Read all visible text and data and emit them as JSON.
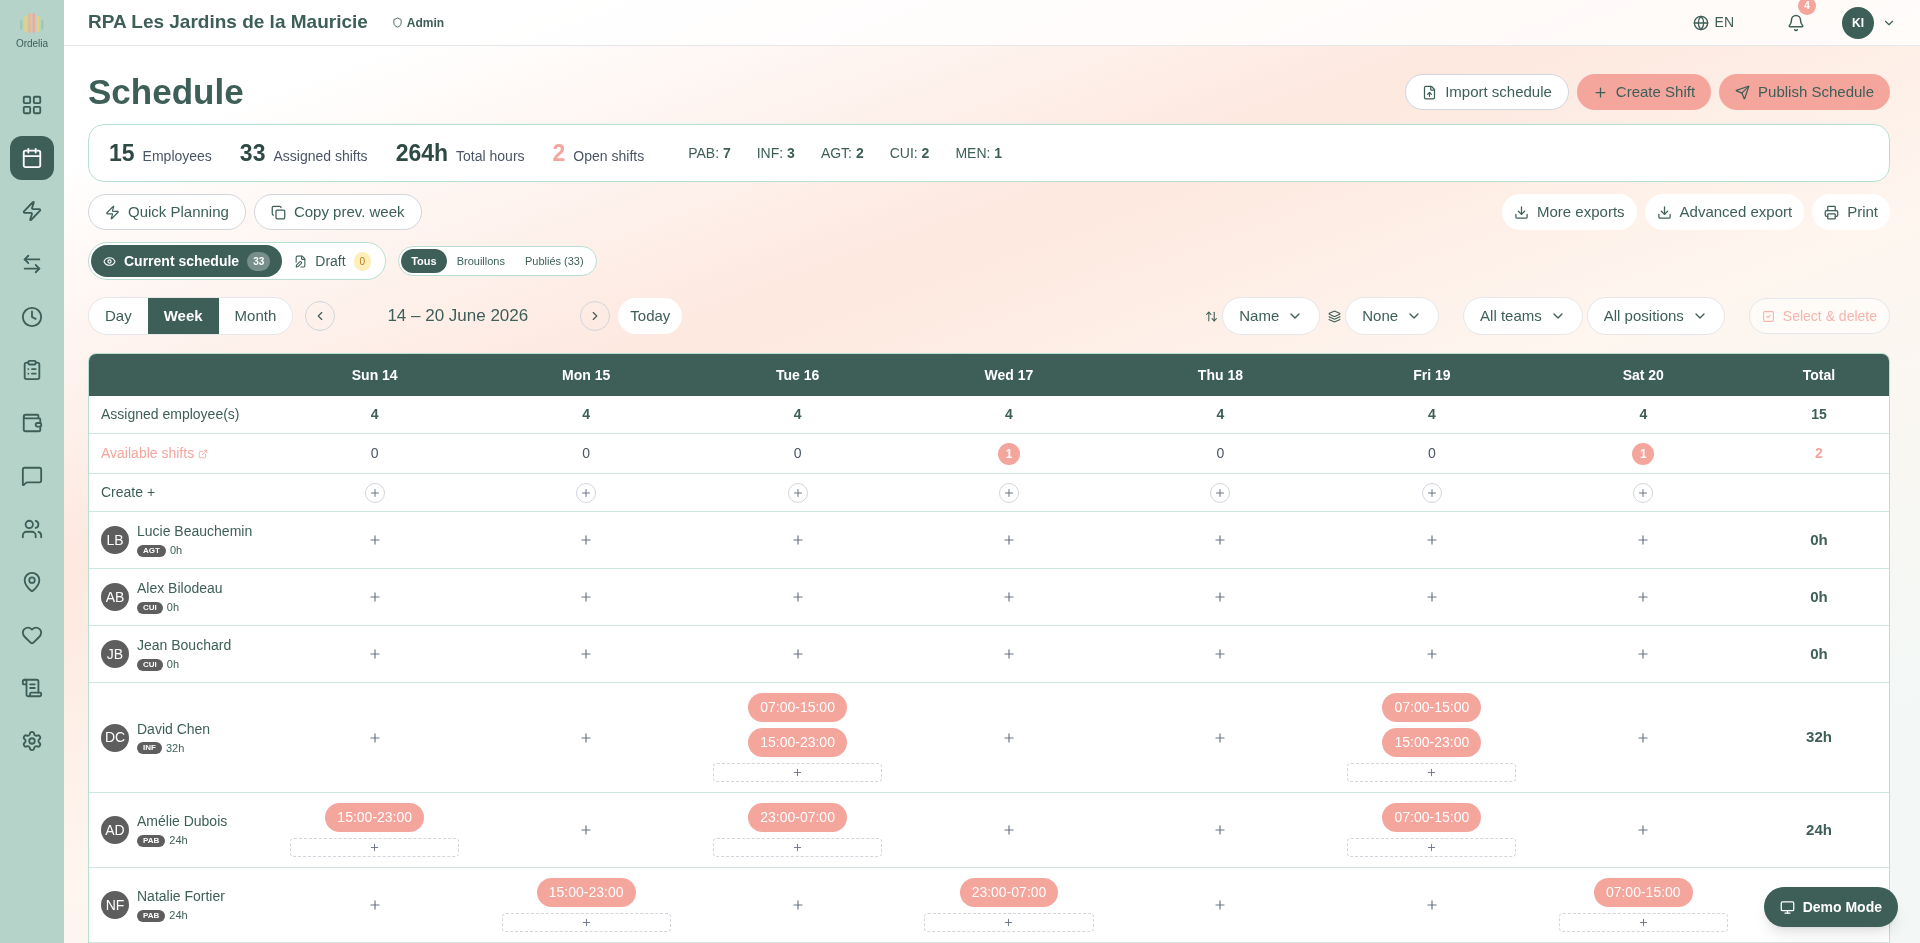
{
  "logo": {
    "name": "Ordelia"
  },
  "sidebar": {
    "items": [
      {
        "selected": false
      },
      {
        "selected": true
      },
      {
        "selected": false
      },
      {
        "selected": false
      },
      {
        "selected": false
      },
      {
        "selected": false
      },
      {
        "selected": false
      },
      {
        "selected": false
      },
      {
        "selected": false
      },
      {
        "selected": false
      },
      {
        "selected": false
      },
      {
        "selected": false
      },
      {
        "selected": false
      }
    ]
  },
  "topbar": {
    "org": "RPA Les Jardins de la Mauricie",
    "role": "Admin",
    "language": "EN",
    "notifications": "4",
    "user": "KI"
  },
  "page": {
    "title": "Schedule",
    "actions": [
      {
        "label": "Import schedule",
        "kind": "outline"
      },
      {
        "label": "Create Shift",
        "kind": "primary"
      },
      {
        "label": "Publish Schedule",
        "kind": "primary"
      }
    ]
  },
  "stats": [
    {
      "value": "15",
      "label": "Employees",
      "highlight": false
    },
    {
      "value": "33",
      "label": "Assigned shifts",
      "highlight": false
    },
    {
      "value": "264h",
      "label": "Total hours",
      "highlight": false
    },
    {
      "value": "2",
      "label": "Open shifts",
      "highlight": true
    }
  ],
  "role_counts": [
    {
      "label": "PAB:",
      "value": "7"
    },
    {
      "label": "INF:",
      "value": "3"
    },
    {
      "label": "AGT:",
      "value": "2"
    },
    {
      "label": "CUI:",
      "value": "2"
    },
    {
      "label": "MEN:",
      "value": "1"
    }
  ],
  "tools_left": [
    "Quick Planning",
    "Copy prev. week"
  ],
  "tools_right": [
    "More exports",
    "Advanced export",
    "Print"
  ],
  "schedule_tabs": [
    {
      "label": "Current schedule",
      "count": "33",
      "selected": true
    },
    {
      "label": "Draft",
      "count": "0",
      "selected": false
    }
  ],
  "status_filter": [
    {
      "label": "Tous",
      "selected": true
    },
    {
      "label": "Brouillons",
      "selected": false
    },
    {
      "label": "Publiés (33)",
      "selected": false
    }
  ],
  "views": [
    {
      "label": "Day",
      "selected": false
    },
    {
      "label": "Week",
      "selected": true
    },
    {
      "label": "Month",
      "selected": false
    }
  ],
  "date_range": "14 – 20 June 2026",
  "today": "Today",
  "sort": "Name",
  "group": "None",
  "teams": "All teams",
  "positions": "All positions",
  "select_delete": {
    "label": "Select & delete",
    "disabled": true
  },
  "table": {
    "columns": [
      "Sun 14",
      "Mon 15",
      "Tue 16",
      "Wed 17",
      "Thu 18",
      "Fri 19",
      "Sat 20"
    ],
    "total_column": "Total",
    "assigned": {
      "label": "Assigned employee(s)",
      "values": [
        "4",
        "4",
        "4",
        "4",
        "4",
        "4",
        "4"
      ],
      "total": "15"
    },
    "available": {
      "label": "Available shifts",
      "values": [
        {
          "value": "0",
          "highlight": false
        },
        {
          "value": "0",
          "highlight": false
        },
        {
          "value": "0",
          "highlight": false
        },
        {
          "value": "1",
          "highlight": true
        },
        {
          "value": "0",
          "highlight": false
        },
        {
          "value": "0",
          "highlight": false
        },
        {
          "value": "1",
          "highlight": true
        }
      ],
      "total": "2"
    },
    "create": {
      "label": "Create +"
    },
    "employees": [
      {
        "initials": "LB",
        "name": "Lucie Beauchemin",
        "role": "AGT",
        "hours": "0h",
        "days": [
          {
            "kind": "empty"
          },
          {
            "kind": "empty"
          },
          {
            "kind": "empty"
          },
          {
            "kind": "empty"
          },
          {
            "kind": "empty"
          },
          {
            "kind": "empty"
          },
          {
            "kind": "empty"
          }
        ],
        "total": "0h"
      },
      {
        "initials": "AB",
        "name": "Alex Bilodeau",
        "role": "CUI",
        "hours": "0h",
        "days": [
          {
            "kind": "empty"
          },
          {
            "kind": "empty"
          },
          {
            "kind": "empty"
          },
          {
            "kind": "empty"
          },
          {
            "kind": "empty"
          },
          {
            "kind": "empty"
          },
          {
            "kind": "empty"
          }
        ],
        "total": "0h"
      },
      {
        "initials": "JB",
        "name": "Jean Bouchard",
        "role": "CUI",
        "hours": "0h",
        "days": [
          {
            "kind": "empty"
          },
          {
            "kind": "empty"
          },
          {
            "kind": "empty"
          },
          {
            "kind": "empty"
          },
          {
            "kind": "empty"
          },
          {
            "kind": "empty"
          },
          {
            "kind": "empty"
          }
        ],
        "total": "0h"
      },
      {
        "initials": "DC",
        "name": "David Chen",
        "role": "INF",
        "hours": "32h",
        "days": [
          {
            "kind": "empty"
          },
          {
            "kind": "empty"
          },
          {
            "kind": "shifts",
            "shifts": [
              "07:00-15:00",
              "15:00-23:00"
            ]
          },
          {
            "kind": "empty"
          },
          {
            "kind": "empty"
          },
          {
            "kind": "shifts",
            "shifts": [
              "07:00-15:00",
              "15:00-23:00"
            ]
          },
          {
            "kind": "empty"
          }
        ],
        "total": "32h"
      },
      {
        "initials": "AD",
        "name": "Amélie Dubois",
        "role": "PAB",
        "hours": "24h",
        "days": [
          {
            "kind": "shifts",
            "shifts": [
              "15:00-23:00"
            ]
          },
          {
            "kind": "empty"
          },
          {
            "kind": "shifts",
            "shifts": [
              "23:00-07:00"
            ]
          },
          {
            "kind": "empty"
          },
          {
            "kind": "empty"
          },
          {
            "kind": "shifts",
            "shifts": [
              "07:00-15:00"
            ]
          },
          {
            "kind": "empty"
          }
        ],
        "total": "24h"
      },
      {
        "initials": "NF",
        "name": "Natalie Fortier",
        "role": "PAB",
        "hours": "24h",
        "days": [
          {
            "kind": "empty"
          },
          {
            "kind": "shifts",
            "shifts": [
              "15:00-23:00"
            ]
          },
          {
            "kind": "empty"
          },
          {
            "kind": "shifts",
            "shifts": [
              "23:00-07:00"
            ]
          },
          {
            "kind": "empty"
          },
          {
            "kind": "empty"
          },
          {
            "kind": "shifts",
            "shifts": [
              "07:00-15:00"
            ]
          }
        ]
      }
    ]
  },
  "demo": "Demo Mode"
}
